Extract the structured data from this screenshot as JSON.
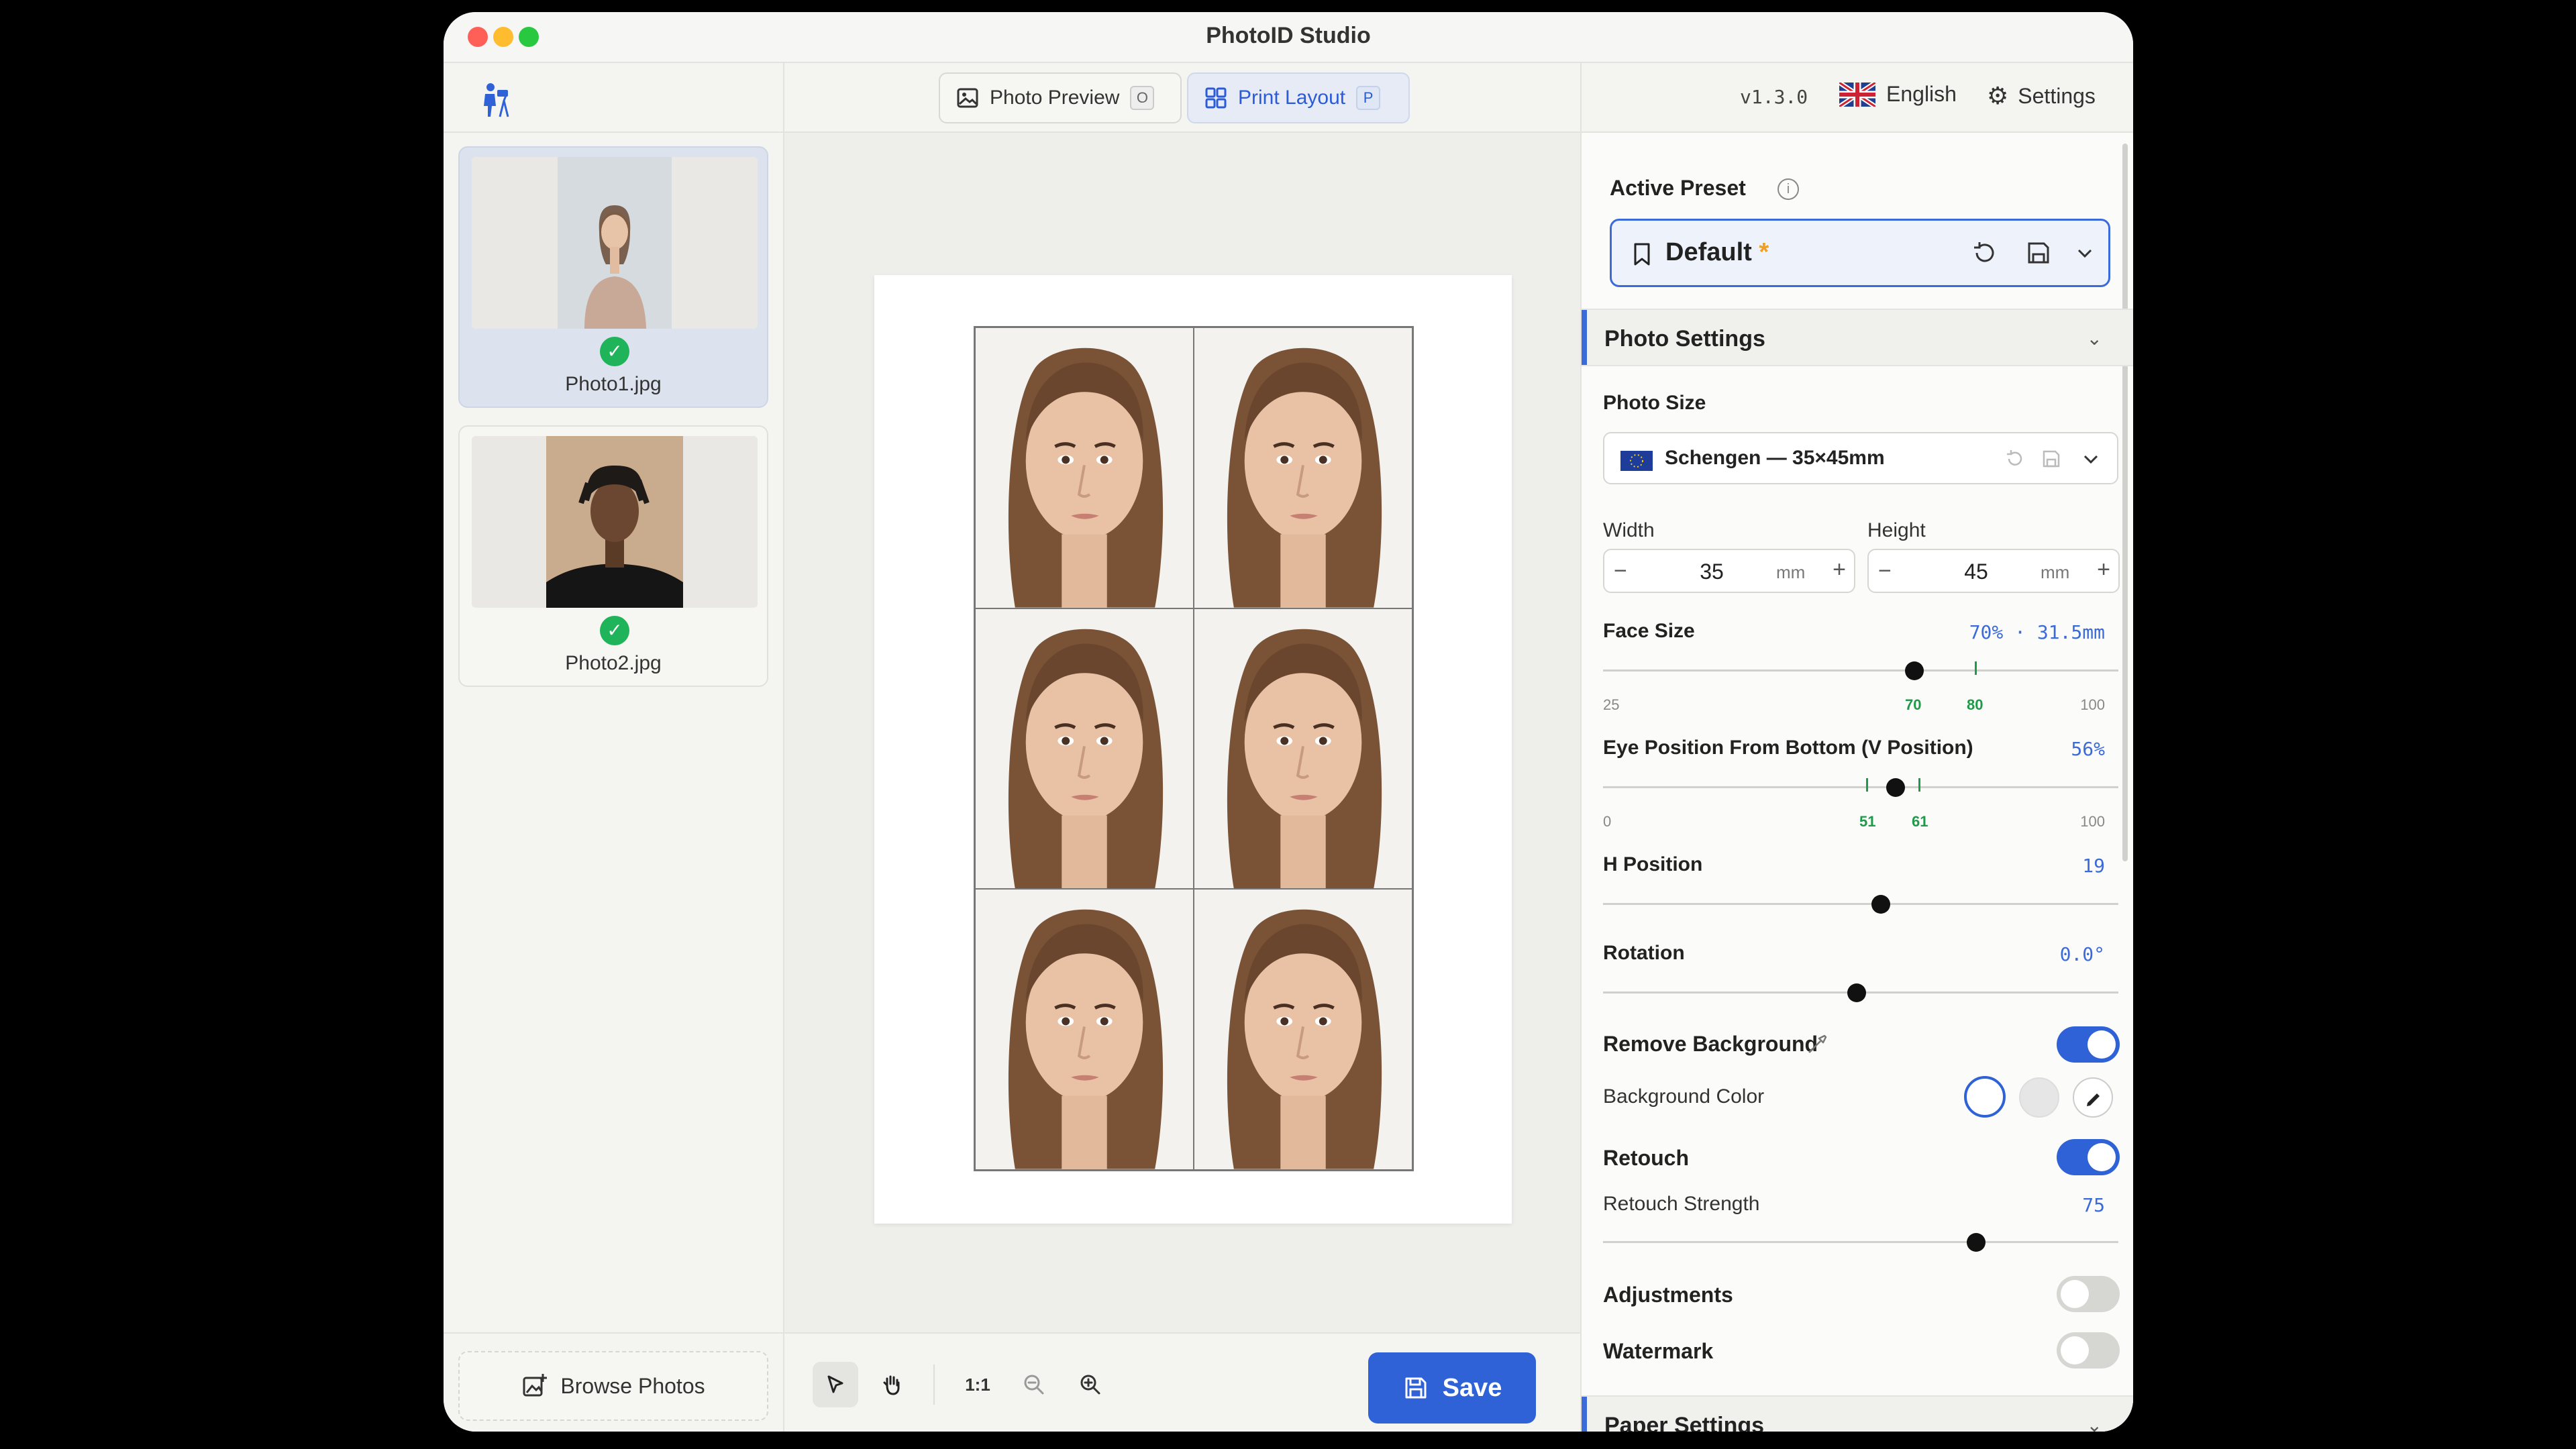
{
  "window": {
    "title": "PhotoID Studio"
  },
  "photos": [
    {
      "name": "Photo1.jpg",
      "status": "ready",
      "active": true
    },
    {
      "name": "Photo2.jpg",
      "status": "ready",
      "active": false
    }
  ],
  "left_footer": {
    "browse_label": "Browse Photos"
  },
  "center": {
    "tabs": [
      {
        "label": "Photo Preview",
        "shortcut": "O",
        "active": false
      },
      {
        "label": "Print Layout",
        "shortcut": "P",
        "active": true
      }
    ],
    "layout": {
      "columns": 2,
      "rows": 3
    },
    "tools": {
      "zoom_reset_label": "1:1"
    },
    "save_label": "Save"
  },
  "right": {
    "version": "v1.3.0",
    "language": "English",
    "settings_label": "Settings",
    "active_preset": {
      "label": "Active Preset",
      "value": "Default",
      "modified_mark": "*"
    },
    "photo_settings": {
      "title": "Photo Settings",
      "photo_size_label": "Photo Size",
      "photo_size_value": "Schengen — 35×45mm",
      "width_label": "Width",
      "width_value": "35",
      "height_label": "Height",
      "height_value": "45",
      "unit": "mm",
      "face_size": {
        "label": "Face Size",
        "value_text": "70% · 31.5mm",
        "value": 70,
        "min_label": "25",
        "max_label": "100",
        "range": [
          70,
          80
        ],
        "range_labels": [
          "70",
          "80"
        ]
      },
      "eye_position": {
        "label": "Eye Position From Bottom (V Position)",
        "value_text": "56%",
        "value": 56,
        "min_label": "0",
        "max_label": "100",
        "range": [
          51,
          61
        ],
        "range_labels": [
          "51",
          "61"
        ]
      },
      "h_position": {
        "label": "H Position",
        "value_text": "19",
        "value": 0.56
      },
      "rotation": {
        "label": "Rotation",
        "value_text": "0.0°",
        "value": 0.51
      },
      "remove_background": {
        "label": "Remove Background",
        "on": true
      },
      "background_color": {
        "label": "Background Color",
        "swatches": [
          "#ffffff",
          "#e6e6e6"
        ]
      },
      "retouch": {
        "label": "Retouch",
        "on": true
      },
      "retouch_strength": {
        "label": "Retouch Strength",
        "value_text": "75",
        "value": 0.75
      },
      "adjustments": {
        "label": "Adjustments",
        "on": false
      },
      "watermark": {
        "label": "Watermark",
        "on": false
      }
    },
    "paper_settings": {
      "title": "Paper Settings"
    }
  },
  "colors": {
    "accent": "#2f62d6",
    "success": "#1fb45a",
    "range_tick": "#1e9a4a"
  }
}
